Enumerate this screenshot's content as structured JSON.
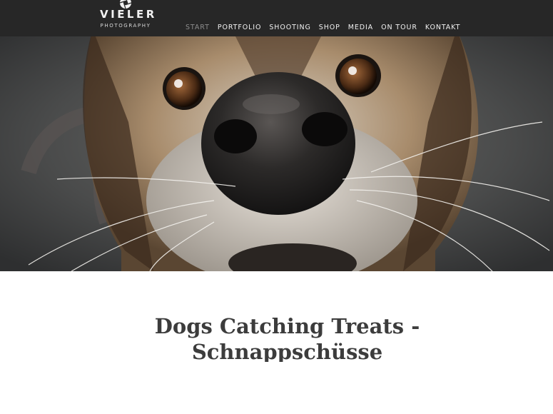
{
  "brand": {
    "name": "VIELER",
    "tagline": "PHOTOGRAPHY",
    "icon": "aperture-icon"
  },
  "nav": {
    "items": [
      {
        "label": "START",
        "active": true
      },
      {
        "label": "PORTFOLIO",
        "active": false
      },
      {
        "label": "SHOOTING",
        "active": false
      },
      {
        "label": "SHOP",
        "active": false
      },
      {
        "label": "MEDIA",
        "active": false
      },
      {
        "label": "ON TOUR",
        "active": false
      },
      {
        "label": "KONTAKT",
        "active": false
      }
    ]
  },
  "hero": {
    "subject": "dog-face-photo"
  },
  "article": {
    "title": "Dogs Catching Treats - Schnappschüsse"
  },
  "colors": {
    "topbar": "#272727",
    "nav_text": "#f1f1f1",
    "nav_active": "#8c8c8c",
    "title_text": "#3c3c3c"
  }
}
